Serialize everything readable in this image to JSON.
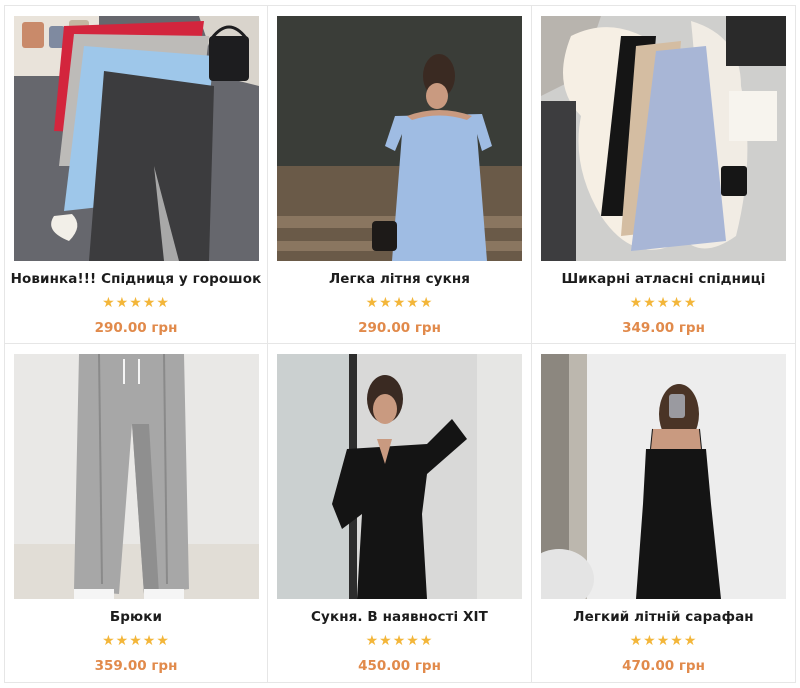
{
  "products": [
    {
      "title": "Новинка!!! Спідниця у горошок",
      "stars": "★★★★★",
      "price": "290.00 грн",
      "image": "skirts-flatlay-image"
    },
    {
      "title": "Легка літня сукня",
      "stars": "★★★★★",
      "price": "290.00 грн",
      "image": "blue-dress-image"
    },
    {
      "title": "Шикарні атласні спідниці",
      "stars": "★★★★★",
      "price": "349.00 грн",
      "image": "satin-skirts-image"
    },
    {
      "title": "Брюки",
      "stars": "★★★★★",
      "price": "359.00 грн",
      "image": "grey-trousers-image"
    },
    {
      "title": "Сукня. В наявності ХІТ",
      "stars": "★★★★★",
      "price": "450.00 грн",
      "image": "black-wrap-dress-image"
    },
    {
      "title": "Легкий літній сарафан",
      "stars": "★★★★★",
      "price": "470.00 грн",
      "image": "black-sundress-image"
    }
  ],
  "colors": {
    "price": "#e18a4b",
    "stars": "#f3b63a",
    "title": "#1c1c1c",
    "border": "#e6e6e6"
  }
}
